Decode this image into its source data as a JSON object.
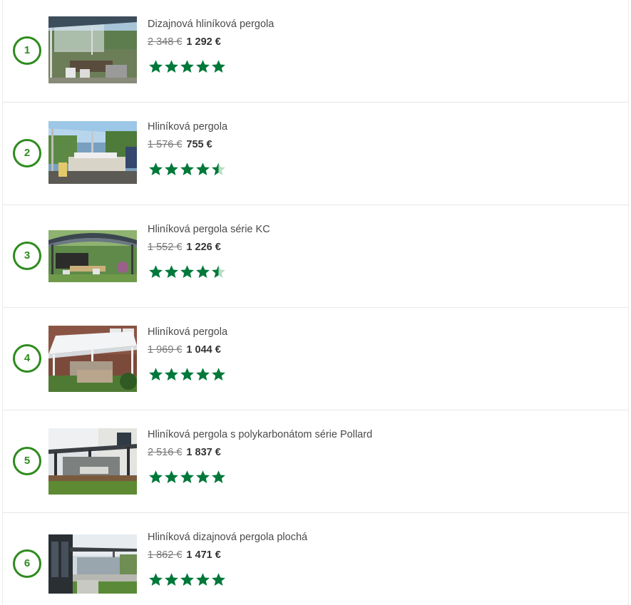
{
  "accent_color": "#00783a",
  "rank_color": "#2e8b1e",
  "products": [
    {
      "rank": "1",
      "title": "Dizajnová hliníková pergola",
      "old_price": "2 348 €",
      "new_price": "1 292 €",
      "rating": 5,
      "image": "modern-pergola-dining-lawn"
    },
    {
      "rank": "2",
      "title": "Hliníková pergola",
      "old_price": "1 576 €",
      "new_price": "755 €",
      "rating": 4.5,
      "image": "glass-pergola-garden-party"
    },
    {
      "rank": "3",
      "title": "Hliníková pergola série KC",
      "old_price": "1 552 €",
      "new_price": "1 226 €",
      "rating": 4.5,
      "image": "arched-pergola-garden"
    },
    {
      "rank": "4",
      "title": "Hliníková pergola",
      "old_price": "1 969 €",
      "new_price": "1 044 €",
      "rating": 5,
      "image": "white-pergola-house-terrace"
    },
    {
      "rank": "5",
      "title": "Hliníková pergola s polykarbonátom série Pollard",
      "old_price": "2 516 €",
      "new_price": "1 837 €",
      "rating": 5,
      "image": "dark-pergola-wooden-deck"
    },
    {
      "rank": "6",
      "title": "Hliníková dizajnová pergola plochá",
      "old_price": "1 862 €",
      "new_price": "1 471 €",
      "rating": 5,
      "image": "flat-pergola-dark-house"
    }
  ]
}
